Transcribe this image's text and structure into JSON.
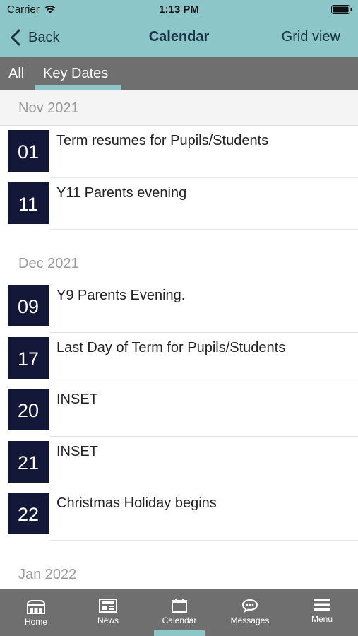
{
  "status_bar": {
    "carrier": "Carrier",
    "time": "1:13 PM"
  },
  "nav": {
    "back_label": "Back",
    "title": "Calendar",
    "grid_label": "Grid view"
  },
  "tabs": [
    {
      "label": "All"
    },
    {
      "label": "Key Dates"
    }
  ],
  "selected_tab": "Key Dates",
  "months": [
    {
      "label": "Nov 2021",
      "events": [
        {
          "day": "01",
          "title": "Term resumes for Pupils/Students"
        },
        {
          "day": "11",
          "title": "Y11 Parents evening"
        }
      ]
    },
    {
      "label": "Dec 2021",
      "events": [
        {
          "day": "09",
          "title": "Y9 Parents Evening."
        },
        {
          "day": "17",
          "title": "Last Day of Term for Pupils/Students"
        },
        {
          "day": "20",
          "title": "INSET"
        },
        {
          "day": "21",
          "title": "INSET"
        },
        {
          "day": "22",
          "title": "Christmas Holiday begins"
        }
      ]
    },
    {
      "label": "Jan 2022",
      "events": []
    }
  ],
  "tab_bar": [
    {
      "label": "Home",
      "icon": "home-icon"
    },
    {
      "label": "News",
      "icon": "news-icon"
    },
    {
      "label": "Calendar",
      "icon": "calendar-icon"
    },
    {
      "label": "Messages",
      "icon": "messages-icon"
    },
    {
      "label": "Menu",
      "icon": "menu-icon"
    }
  ],
  "active_tab_bar_item": "Calendar",
  "colors": {
    "accent": "#8cc6c9",
    "bar_gray": "#6f6f6f",
    "date_box": "#141838",
    "nav_text": "#163244"
  }
}
